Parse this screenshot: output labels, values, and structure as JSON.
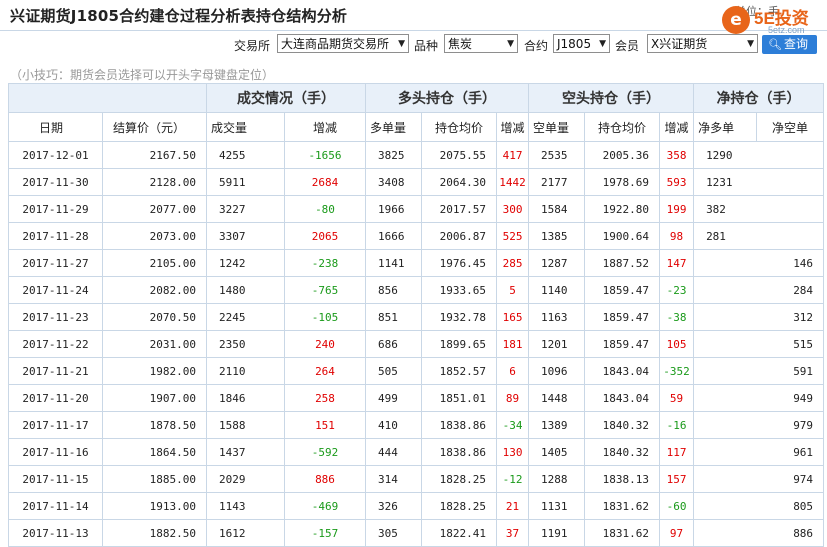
{
  "header": {
    "title": "兴证期货J1805合约建仓过程分析表持仓结构分析",
    "unit_text": "单位：手",
    "logo": {
      "brand": "5E投资",
      "domain": "5etz.com",
      "icon": "logo-e-icon",
      "color": "#e8651a"
    }
  },
  "filters": {
    "exchange_label": "交易所",
    "exchange_value": "大连商品期货交易所",
    "variety_label": "品种",
    "variety_value": "焦炭",
    "contract_label": "合约",
    "contract_value": "J1805",
    "member_label": "会员",
    "member_value": "X兴证期货",
    "query_label": "查询",
    "query_icon": "search-icon",
    "accent": "#2d7ed8"
  },
  "tip": "（小技巧：期货会员选择可以开头字母键盘定位）",
  "table": {
    "group_headers": {
      "volume": "成交情况（手）",
      "long": "多头持仓（手）",
      "short": "空头持仓（手）",
      "net": "净持仓（手）"
    },
    "columns": [
      "日期",
      "结算价（元）",
      "成交量",
      "增减",
      "多单量",
      "持仓均价",
      "增减",
      "空单量",
      "持仓均价",
      "增减",
      "净多单",
      "净空单"
    ],
    "colors": {
      "increase": "#e00000",
      "decrease": "#1a9a1a"
    },
    "rows": [
      [
        "2017-12-01",
        "2167.50",
        "4255",
        "-1656",
        "3825",
        "2075.55",
        "417",
        "2535",
        "2005.36",
        "358",
        "1290",
        ""
      ],
      [
        "2017-11-30",
        "2128.00",
        "5911",
        "2684",
        "3408",
        "2064.30",
        "1442",
        "2177",
        "1978.69",
        "593",
        "1231",
        ""
      ],
      [
        "2017-11-29",
        "2077.00",
        "3227",
        "-80",
        "1966",
        "2017.57",
        "300",
        "1584",
        "1922.80",
        "199",
        "382",
        ""
      ],
      [
        "2017-11-28",
        "2073.00",
        "3307",
        "2065",
        "1666",
        "2006.87",
        "525",
        "1385",
        "1900.64",
        "98",
        "281",
        ""
      ],
      [
        "2017-11-27",
        "2105.00",
        "1242",
        "-238",
        "1141",
        "1976.45",
        "285",
        "1287",
        "1887.52",
        "147",
        "",
        "146"
      ],
      [
        "2017-11-24",
        "2082.00",
        "1480",
        "-765",
        "856",
        "1933.65",
        "5",
        "1140",
        "1859.47",
        "-23",
        "",
        "284"
      ],
      [
        "2017-11-23",
        "2070.50",
        "2245",
        "-105",
        "851",
        "1932.78",
        "165",
        "1163",
        "1859.47",
        "-38",
        "",
        "312"
      ],
      [
        "2017-11-22",
        "2031.00",
        "2350",
        "240",
        "686",
        "1899.65",
        "181",
        "1201",
        "1859.47",
        "105",
        "",
        "515"
      ],
      [
        "2017-11-21",
        "1982.00",
        "2110",
        "264",
        "505",
        "1852.57",
        "6",
        "1096",
        "1843.04",
        "-352",
        "",
        "591"
      ],
      [
        "2017-11-20",
        "1907.00",
        "1846",
        "258",
        "499",
        "1851.01",
        "89",
        "1448",
        "1843.04",
        "59",
        "",
        "949"
      ],
      [
        "2017-11-17",
        "1878.50",
        "1588",
        "151",
        "410",
        "1838.86",
        "-34",
        "1389",
        "1840.32",
        "-16",
        "",
        "979"
      ],
      [
        "2017-11-16",
        "1864.50",
        "1437",
        "-592",
        "444",
        "1838.86",
        "130",
        "1405",
        "1840.32",
        "117",
        "",
        "961"
      ],
      [
        "2017-11-15",
        "1885.00",
        "2029",
        "886",
        "314",
        "1828.25",
        "-12",
        "1288",
        "1838.13",
        "157",
        "",
        "974"
      ],
      [
        "2017-11-14",
        "1913.00",
        "1143",
        "-469",
        "326",
        "1828.25",
        "21",
        "1131",
        "1831.62",
        "-60",
        "",
        "805"
      ],
      [
        "2017-11-13",
        "1882.50",
        "1612",
        "-157",
        "305",
        "1822.41",
        "37",
        "1191",
        "1831.62",
        "97",
        "",
        "886"
      ]
    ]
  }
}
